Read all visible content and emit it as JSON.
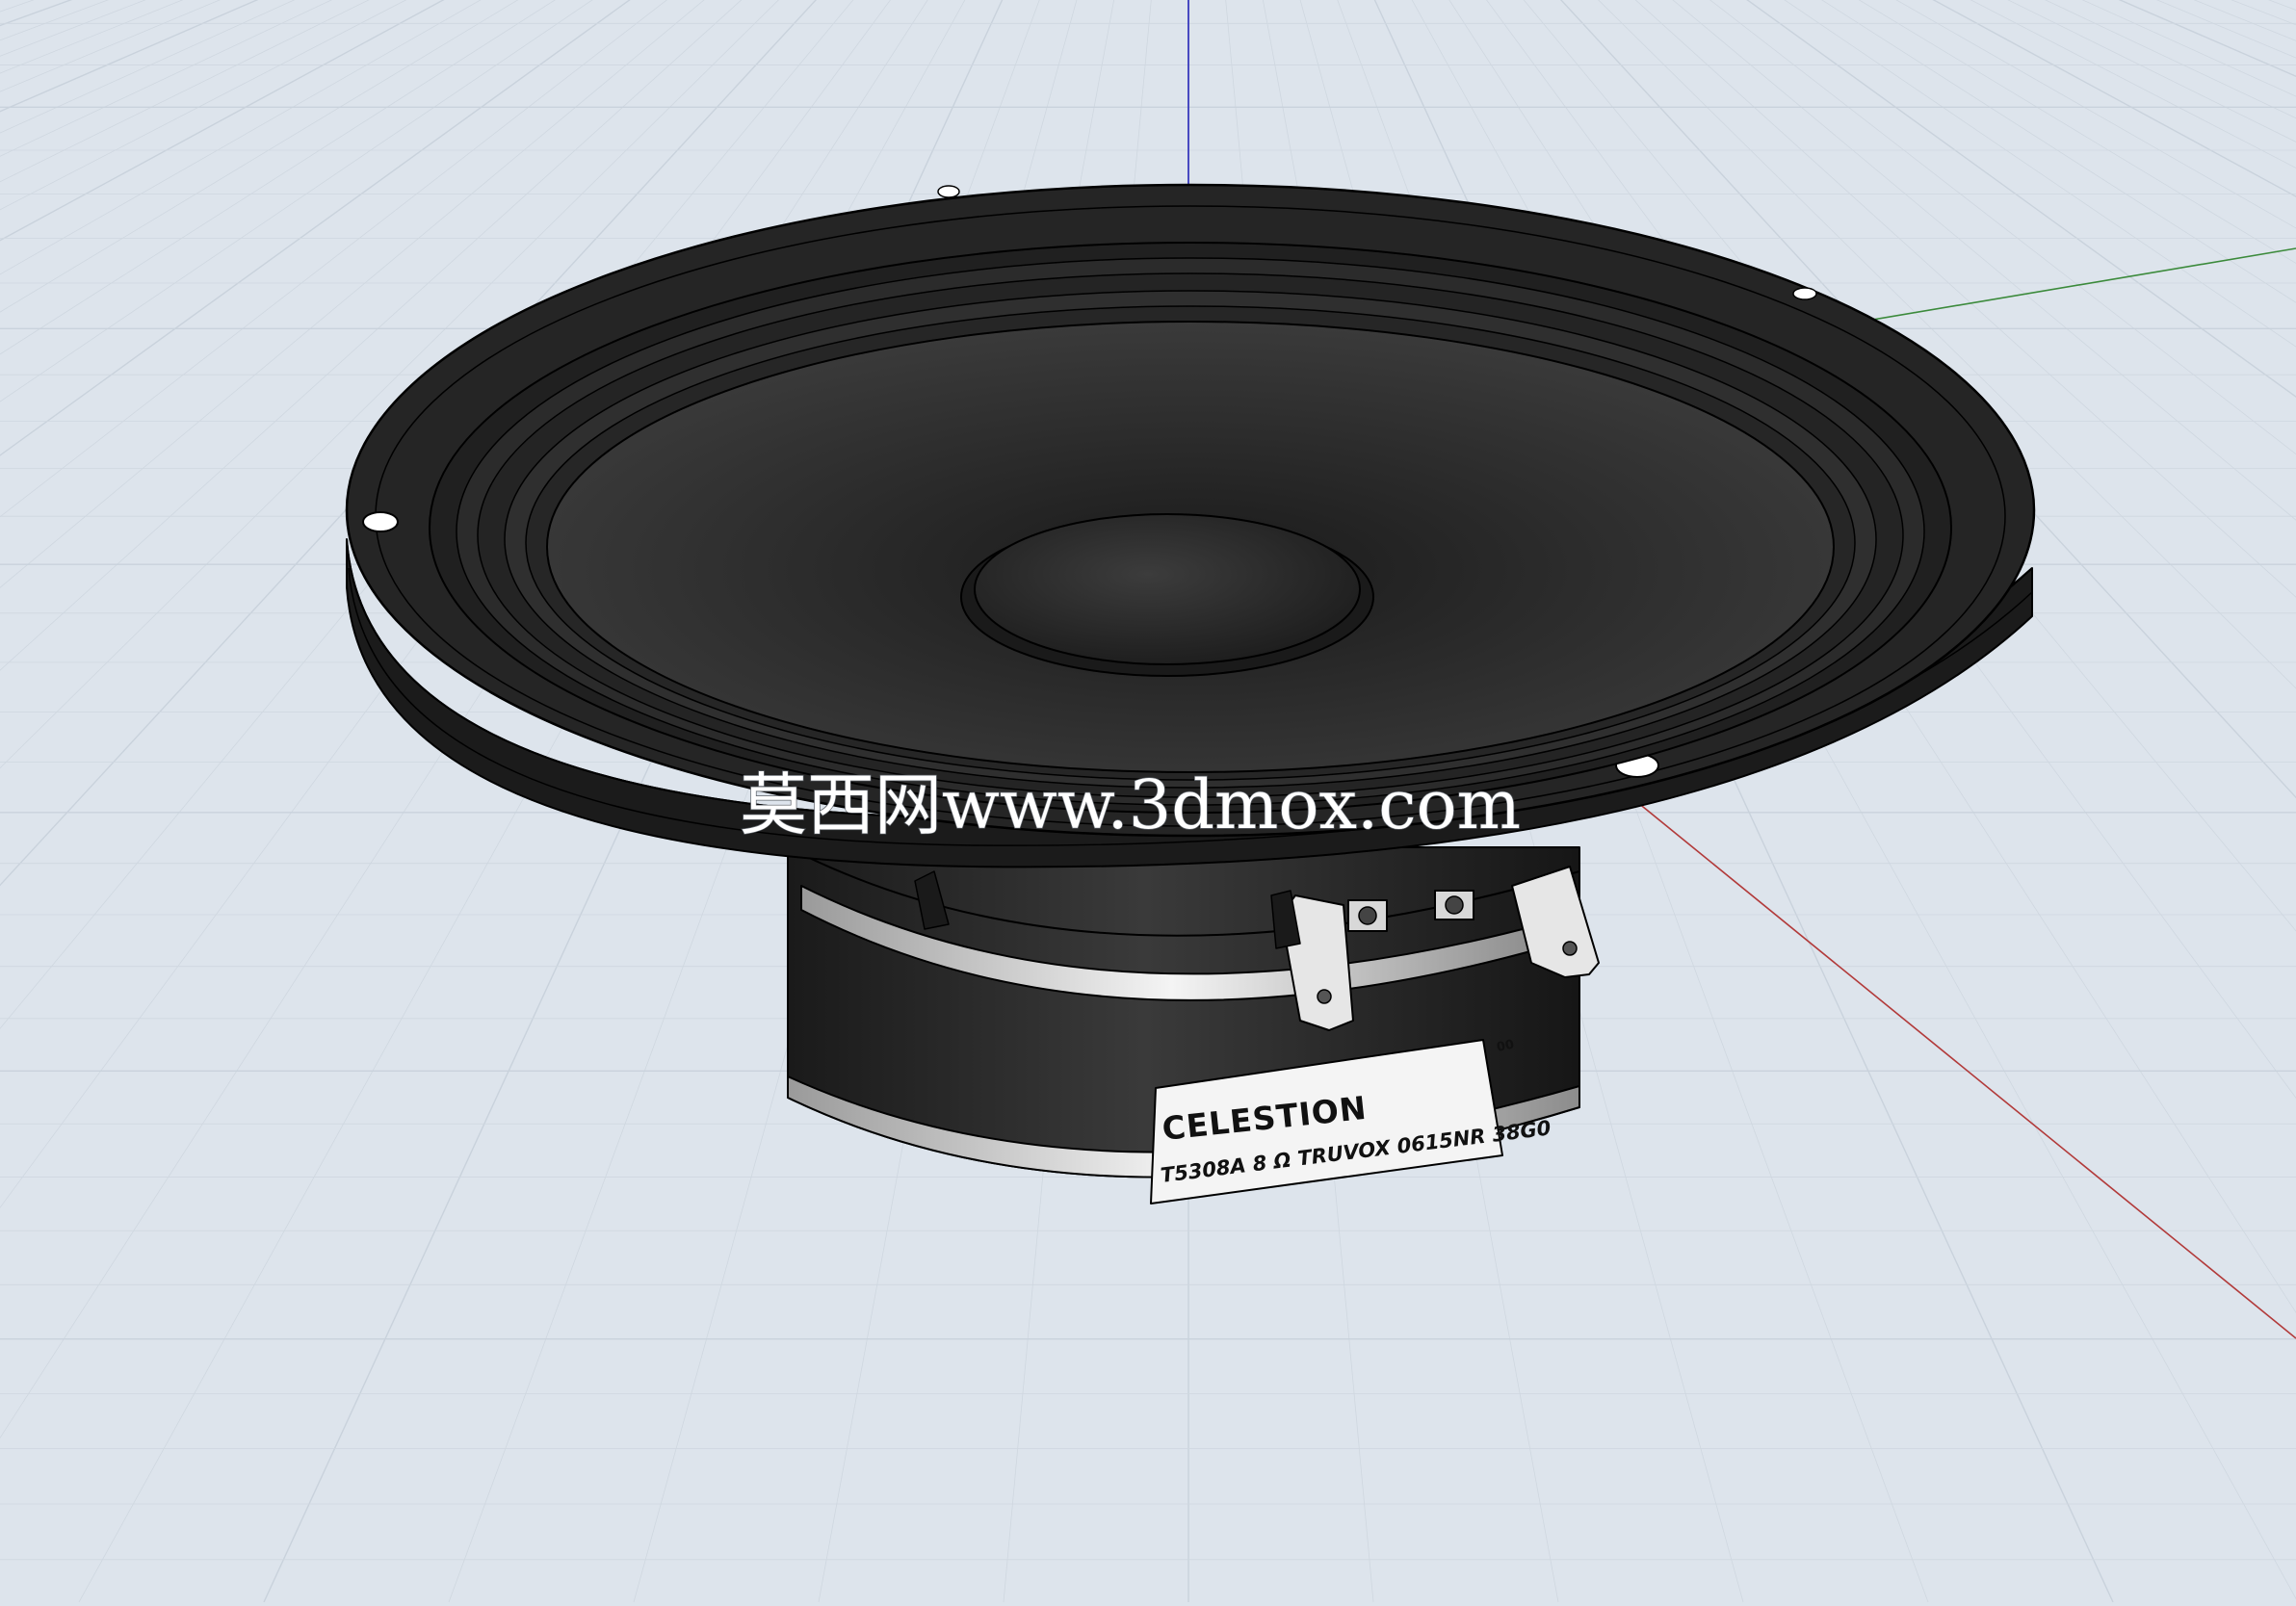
{
  "scene": {
    "background_color": "#dde4ec",
    "grid_minor_color": "#eef2f6",
    "grid_major_color": "#c9d2dc",
    "axis_colors": {
      "red": "#b23a3a",
      "green": "#3b8a3b",
      "blue": "#2626b8"
    }
  },
  "model": {
    "name": "speaker-driver",
    "cone_color": "#2a2a2a",
    "frame_color": "#1e1e1e",
    "magnet_color": "#232323",
    "edge_color": "#000000"
  },
  "label": {
    "brand": "CELESTION",
    "spec": "T5308A  8 Ω  TRUVOX 0615NR 38G0",
    "tag": "00"
  },
  "watermark": {
    "text": "莫西网www.3dmox.com"
  }
}
